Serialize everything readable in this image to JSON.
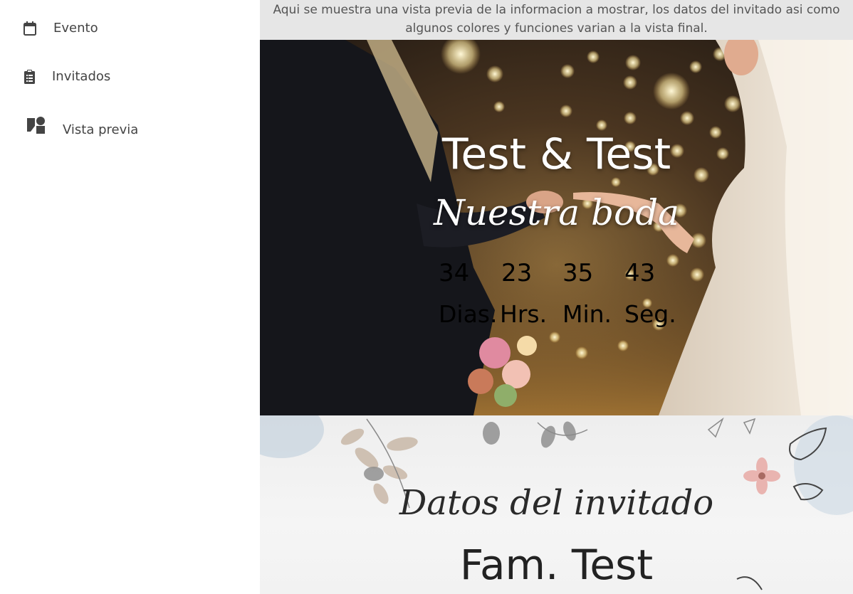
{
  "sidebar": {
    "items": [
      {
        "label": "Evento",
        "icon": "calendar-icon"
      },
      {
        "label": "Invitados",
        "icon": "clipboard-list-icon"
      },
      {
        "label": "Vista previa",
        "icon": "shapes-preview-icon"
      }
    ]
  },
  "preview": {
    "notice": "Aqui se muestra una vista previa de la informacion a mostrar, los datos del invitado asi como algunos colores y funciones varian a la vista final.",
    "hero": {
      "title": "Test & Test",
      "subtitle": "Nuestra boda",
      "countdown": [
        {
          "value": "34",
          "label": "Dias."
        },
        {
          "value": "23",
          "label": "Hrs."
        },
        {
          "value": "35",
          "label": "Min."
        },
        {
          "value": "43",
          "label": "Seg."
        }
      ]
    },
    "guest_section": {
      "title": "Datos del invitado",
      "guest_name": "Fam. Test"
    }
  },
  "colors": {
    "sidebar_bg": "#ffffff",
    "notice_bg": "#e6e6e6",
    "text_dark": "#444444",
    "hero_text": "#ffffff"
  }
}
